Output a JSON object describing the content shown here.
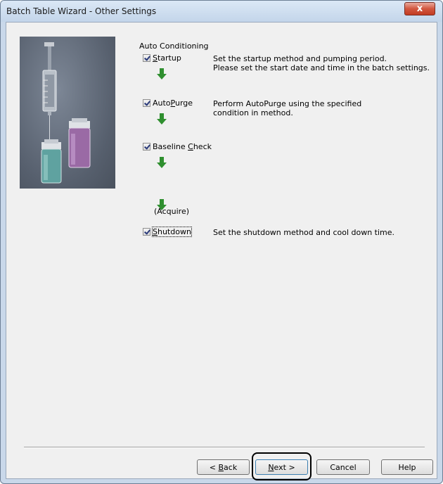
{
  "window": {
    "title": "Batch Table Wizard - Other Settings",
    "close_glyph": "x"
  },
  "section": {
    "label": "Auto Conditioning"
  },
  "steps": {
    "startup": {
      "label_pre": "",
      "label_key": "S",
      "label_post": "tartup",
      "checked": true,
      "desc1": "Set the startup method and pumping period.",
      "desc2": "Please set the start date and time in the batch settings."
    },
    "autopurge": {
      "label_pre": "Auto",
      "label_key": "P",
      "label_post": "urge",
      "checked": true,
      "desc1": "Perform AutoPurge using the specified",
      "desc2": "condition in method."
    },
    "baseline": {
      "label_pre": "Baseline ",
      "label_key": "C",
      "label_post": "heck",
      "checked": true
    },
    "acquire": {
      "label": "(Acquire)"
    },
    "shutdown": {
      "label_pre": "",
      "label_key": "S",
      "label_post": "hutdown",
      "checked": true,
      "desc1": "Set the shutdown method and cool down time."
    }
  },
  "arrow_color": "#2f8f2f",
  "buttons": {
    "back": {
      "pre": "< ",
      "key": "B",
      "post": "ack"
    },
    "next": {
      "pre": "",
      "key": "N",
      "post": "ext >"
    },
    "cancel": {
      "label": "Cancel"
    },
    "help": {
      "label": "Help"
    }
  }
}
